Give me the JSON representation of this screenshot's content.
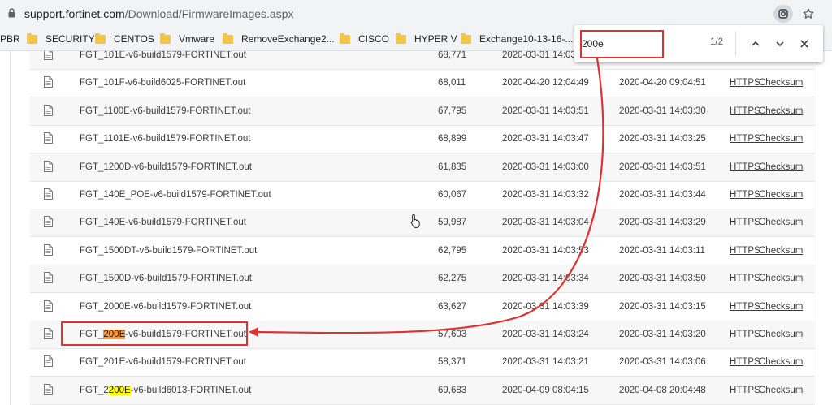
{
  "browser": {
    "url_host": "support.fortinet.com",
    "url_path": "/Download/FirmwareImages.aspx"
  },
  "bookmarks": [
    {
      "label": "PBR"
    },
    {
      "label": "SECURITY"
    },
    {
      "label": "CENTOS"
    },
    {
      "label": "Vmware"
    },
    {
      "label": "RemoveExchange2..."
    },
    {
      "label": "CISCO"
    },
    {
      "label": "HYPER V"
    },
    {
      "label": "Exchange10-13-16-..."
    }
  ],
  "find": {
    "query": "200e",
    "count": "1/2"
  },
  "table": {
    "link_https": "HTTPS",
    "link_checksum": "Checksum",
    "rows": [
      {
        "pre": "FGT_101E-v6-build1579-FORTINET.out",
        "hit": "",
        "post": "",
        "size": "68,771",
        "date1": "2020-03-31 14:03:25",
        "date2": ""
      },
      {
        "pre": "FGT_101F-v6-build6025-FORTINET.out",
        "hit": "",
        "post": "",
        "size": "68,011",
        "date1": "2020-04-20 12:04:49",
        "date2": "2020-04-20 09:04:51"
      },
      {
        "pre": "FGT_1100E-v6-build1579-FORTINET.out",
        "hit": "",
        "post": "",
        "size": "67,795",
        "date1": "2020-03-31 14:03:51",
        "date2": "2020-03-31 14:03:30"
      },
      {
        "pre": "FGT_1101E-v6-build1579-FORTINET.out",
        "hit": "",
        "post": "",
        "size": "68,899",
        "date1": "2020-03-31 14:03:47",
        "date2": "2020-03-31 14:03:25"
      },
      {
        "pre": "FGT_1200D-v6-build1579-FORTINET.out",
        "hit": "",
        "post": "",
        "size": "61,835",
        "date1": "2020-03-31 14:03:00",
        "date2": "2020-03-31 14:03:51"
      },
      {
        "pre": "FGT_140E_POE-v6-build1579-FORTINET.out",
        "hit": "",
        "post": "",
        "size": "60,067",
        "date1": "2020-03-31 14:03:32",
        "date2": "2020-03-31 14:03:44"
      },
      {
        "pre": "FGT_140E-v6-build1579-FORTINET.out",
        "hit": "",
        "post": "",
        "size": "59,987",
        "date1": "2020-03-31 14:03:04",
        "date2": "2020-03-31 14:03:29"
      },
      {
        "pre": "FGT_1500DT-v6-build1579-FORTINET.out",
        "hit": "",
        "post": "",
        "size": "62,795",
        "date1": "2020-03-31 14:03:53",
        "date2": "2020-03-31 14:03:11"
      },
      {
        "pre": "FGT_1500D-v6-build1579-FORTINET.out",
        "hit": "",
        "post": "",
        "size": "62,275",
        "date1": "2020-03-31 14:03:34",
        "date2": "2020-03-31 14:03:50"
      },
      {
        "pre": "FGT_2000E-v6-build1579-FORTINET.out",
        "hit": "",
        "post": "",
        "size": "63,627",
        "date1": "2020-03-31 14:03:39",
        "date2": "2020-03-31 14:03:15"
      },
      {
        "pre": "FGT_",
        "hit": "200E",
        "post": "-v6-build1579-FORTINET.out",
        "current": true,
        "size": "57,603",
        "date1": "2020-03-31 14:03:24",
        "date2": "2020-03-31 14:03:20"
      },
      {
        "pre": "FGT_201E-v6-build1579-FORTINET.out",
        "hit": "",
        "post": "",
        "size": "58,371",
        "date1": "2020-03-31 14:03:21",
        "date2": "2020-03-31 14:03:06"
      },
      {
        "pre": "FGT_2",
        "hit": "200E",
        "post": "-v6-build6013-FORTINET.out",
        "size": "69,683",
        "date1": "2020-04-09 08:04:15",
        "date2": "2020-04-08 20:04:48"
      }
    ]
  }
}
